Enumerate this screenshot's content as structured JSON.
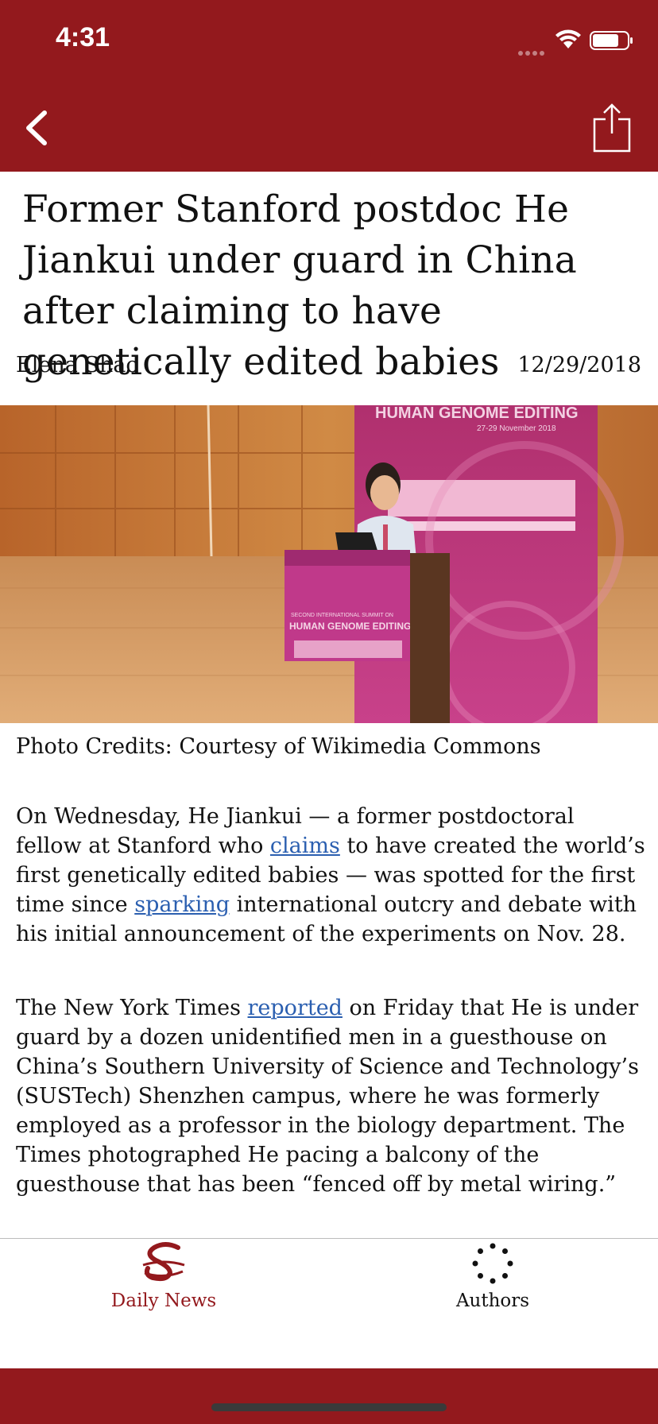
{
  "status_bar": {
    "time": "4:31"
  },
  "article": {
    "title": "Former Stanford postdoc He Jiankui under guard in China after claiming to have genetically edited babies",
    "author": "Elena Shao",
    "date": "12/29/2018",
    "photo": {
      "banner_text": "HUMAN GENOME EDITING",
      "banner_date": "27-29 November 2018",
      "podium_line1": "SECOND INTERNATIONAL SUMMIT ON",
      "podium_line2": "HUMAN GENOME EDITING"
    },
    "photo_credits": "Photo Credits: Courtesy of Wikimedia Commons",
    "paragraph1": {
      "t1": "On Wednesday, He Jiankui — a former postdoctoral fellow at Stanford who ",
      "link1": "claims",
      "t2": " to have created the world’s first genetically edited babies — was spotted for the first time since ",
      "link2": "sparking",
      "t3": " international outcry and debate with his initial announcement of the experiments on Nov. 28."
    },
    "paragraph2": {
      "t1": "The New York Times ",
      "link1": "reported",
      "t2": " on Friday that He is under guard by a dozen unidentified men in a guesthouse on China’s Southern University of Science and Technology’s (SUSTech) Shenzhen campus, where he was formerly employed as a professor in the biology department. The Times photographed He pacing a balcony of the guesthouse that has been “fenced off by metal wiring.”"
    }
  },
  "tab_bar": {
    "daily_news_label": "Daily News",
    "authors_label": "Authors"
  },
  "colors": {
    "brand": "#93191d",
    "link": "#2b5fb0"
  },
  "icons": {
    "back": "chevron-left-icon",
    "share": "share-icon",
    "daily_news": "stanford-daily-logo-icon",
    "authors": "dotted-circle-icon"
  }
}
